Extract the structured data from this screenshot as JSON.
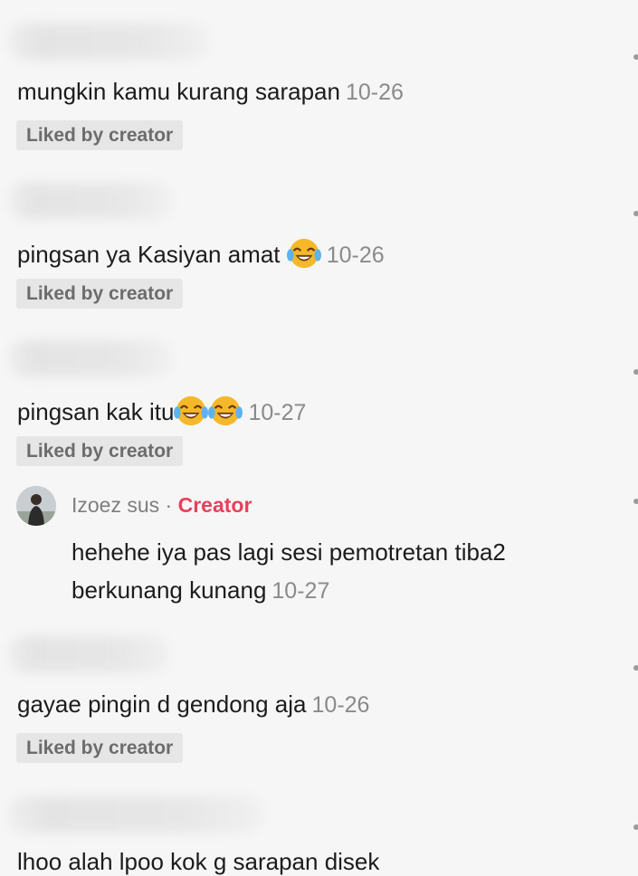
{
  "comments": [
    {
      "text": "mungkin kamu kurang sarapan",
      "date": "10-26",
      "liked_label": "Liked by creator",
      "emoji": []
    },
    {
      "text": "pingsan ya Kasiyan amat",
      "date": "10-26",
      "liked_label": "Liked by creator",
      "emoji": [
        "face-with-tears-of-joy"
      ]
    },
    {
      "text": "pingsan kak itu",
      "date": "10-27",
      "liked_label": "Liked by creator",
      "emoji": [
        "face-with-tears-of-joy",
        "face-with-tears-of-joy"
      ]
    },
    {
      "text": "gayae pingin d gendong aja",
      "date": "10-26",
      "liked_label": "Liked by creator",
      "emoji": []
    },
    {
      "text": "lhoo alah lpoo kok g sarapan disek"
    }
  ],
  "reply": {
    "username": "Izoez sus",
    "separator": "·",
    "badge": "Creator",
    "text": "hehehe iya pas lagi sesi pemotretan tiba2 berkunang kunang",
    "date": "10-27"
  },
  "colors": {
    "background": "#f6f6f6",
    "creator_badge": "#e8405b",
    "date_text": "#8a8a8a",
    "liked_chip_bg": "#e6e6e6"
  }
}
